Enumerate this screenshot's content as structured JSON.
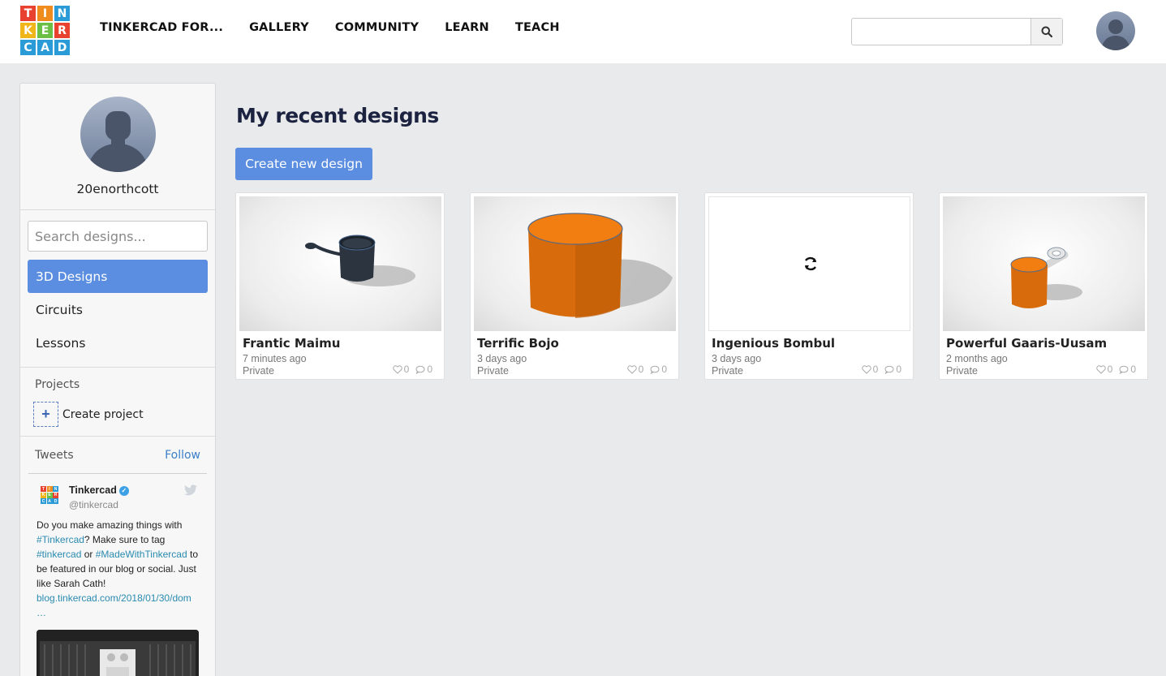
{
  "brand": {
    "logo_letters": [
      "T",
      "I",
      "N",
      "K",
      "E",
      "R",
      "C",
      "A",
      "D"
    ],
    "logo_colors": [
      "#e8412f",
      "#f08c1e",
      "#2a9bd6",
      "#f0b519",
      "#6bbf44",
      "#e8412f",
      "#2a9bd6",
      "#2a9bd6",
      "#2a9bd6"
    ]
  },
  "nav": {
    "items": [
      "TINKERCAD FOR...",
      "GALLERY",
      "COMMUNITY",
      "LEARN",
      "TEACH"
    ]
  },
  "top_search": {
    "placeholder": "",
    "icon": "search-icon"
  },
  "profile": {
    "username": "20enorthcott"
  },
  "sidebar": {
    "search_placeholder": "Search designs...",
    "items": [
      {
        "label": "3D Designs",
        "active": true
      },
      {
        "label": "Circuits",
        "active": false
      },
      {
        "label": "Lessons",
        "active": false
      }
    ],
    "projects_label": "Projects",
    "create_project_label": "Create project",
    "tweets_label": "Tweets",
    "follow_label": "Follow"
  },
  "tweet": {
    "name": "Tinkercad",
    "handle": "@tinkercad",
    "text_1": "Do you make amazing things with ",
    "link_1": "#Tinkercad",
    "text_2": "? Make sure to tag ",
    "link_2": "#tinkercad",
    "text_3": " or ",
    "link_3": "#MadeWithTinkercad",
    "text_4": " to be featured in our blog or social. Just like Sarah Cath! ",
    "link_4": "blog.tinkercad.com/2018/01/30/dom …"
  },
  "main": {
    "title": "My recent designs",
    "create_button": "Create new design"
  },
  "designs": [
    {
      "title": "Frantic Maimu",
      "time": "7 minutes ago",
      "privacy": "Private",
      "likes": "0",
      "comments": "0"
    },
    {
      "title": "Terrific Bojo",
      "time": "3 days ago",
      "privacy": "Private",
      "likes": "0",
      "comments": "0"
    },
    {
      "title": "Ingenious Bombul",
      "time": "3 days ago",
      "privacy": "Private",
      "likes": "0",
      "comments": "0"
    },
    {
      "title": "Powerful Gaaris-Uusam",
      "time": "2 months ago",
      "privacy": "Private",
      "likes": "0",
      "comments": "0"
    }
  ],
  "colors": {
    "accent": "#5b8ee0",
    "orange": "#f07a10",
    "background": "#e9eaec"
  }
}
